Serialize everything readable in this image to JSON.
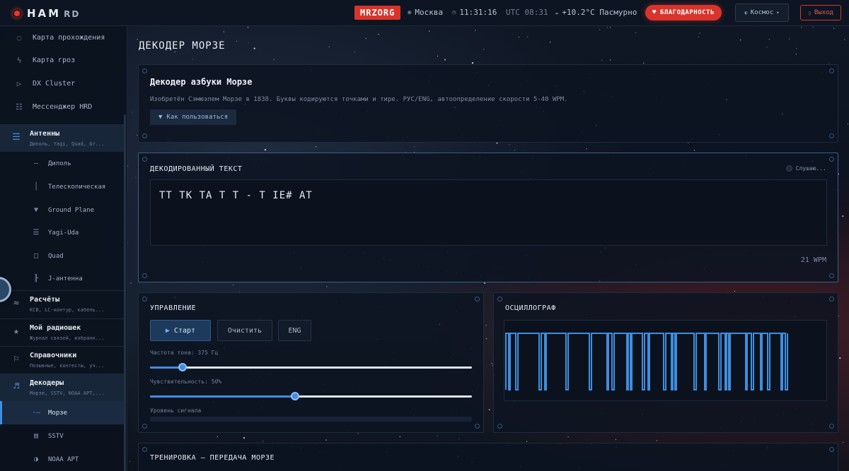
{
  "app": {
    "logo_text": "HAM",
    "logo_suffix": "RD"
  },
  "topbar": {
    "callsign": "MRZORG",
    "city": "Москва",
    "local_time": "11:31:16",
    "utc_label": "UTC 08:31",
    "weather": "+10.2°C Пасмурно",
    "thanks_label": "БЛАГОДАРНОСТЬ",
    "theme_label": "Космос",
    "exit_label": "Выход"
  },
  "sidebar": {
    "top_items": [
      {
        "icon": "compass-icon",
        "label": "Карта прохождения"
      },
      {
        "icon": "lightning-icon",
        "label": "Карта гроз"
      },
      {
        "icon": "play-icon",
        "label": "DX Cluster"
      },
      {
        "icon": "chat-icon",
        "label": "Мессенджер HRD"
      }
    ],
    "groups": {
      "antennas": {
        "title": "Антенны",
        "subtitle": "Диполь, Yagi, Quad, Gr..."
      },
      "calcs": {
        "title": "Расчёты",
        "subtitle": "КСВ, LC-контур, кабель..."
      },
      "myradio": {
        "title": "Мой радиошек",
        "subtitle": "Журнал связей, избранн..."
      },
      "refs": {
        "title": "Справочники",
        "subtitle": "Позывные, контесты, уч..."
      },
      "decoders": {
        "title": "Декодеры",
        "subtitle": "Морзе, SSTV, NOAA APT,..."
      }
    },
    "antenna_items": [
      "Диполь",
      "Телескопическая",
      "Ground Plane",
      "Yagi-Uda",
      "Quad",
      "J-антенна"
    ],
    "decoder_items": [
      "Морзе",
      "SSTV",
      "NOAA APT"
    ]
  },
  "main": {
    "page_title": "ДЕКОДЕР МОРЗЕ",
    "info": {
      "title": "Декодер азбуки Морзе",
      "description": "Изобретён Сэмюэлем Морзе в 1838. Буквы кодируются точками и тире. РУС/ENG, автоопределение скорости 5-40 WPM.",
      "howto_label": "Как пользоваться"
    },
    "decoded": {
      "title": "ДЕКОДИРОВАННЫЙ ТЕКСТ",
      "status": "Слушаю...",
      "text": "TT TK TA T T - T IE# AT",
      "wpm": "21 WPM"
    },
    "controls": {
      "title": "УПРАВЛЕНИЕ",
      "start_label": "Старт",
      "clear_label": "Очистить",
      "lang_label": "ENG",
      "tone_label": "Частота тона: 375 Гц",
      "tone_value": 0.1,
      "sens_label": "Чувствительность: 50%",
      "sens_value": 0.45,
      "level_label": "Уровень сигнала",
      "level_value": 0
    },
    "scope": {
      "title": "ОСЦИЛЛОГРАФ"
    },
    "training": {
      "title": "ТРЕНИРОВКА — ПЕРЕДАЧА МОРЗЕ"
    }
  },
  "colors": {
    "accent": "#3f8ee0",
    "brand_red": "#d9342c"
  }
}
